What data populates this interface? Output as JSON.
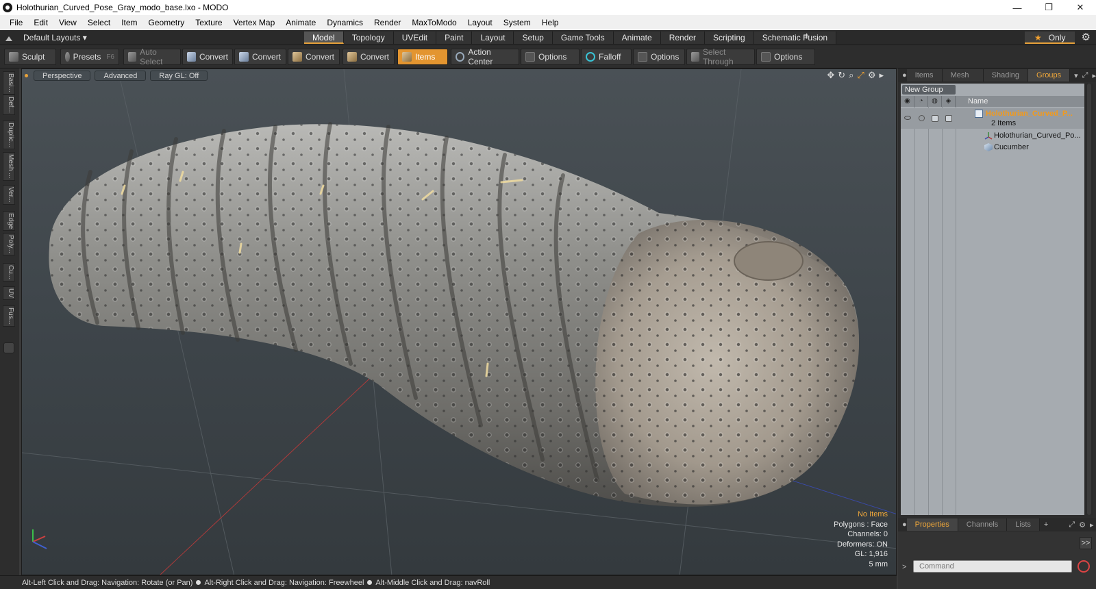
{
  "window": {
    "title": "Holothurian_Curved_Pose_Gray_modo_base.lxo - MODO",
    "controls": [
      "—",
      "❐",
      "✕"
    ]
  },
  "menu": [
    "File",
    "Edit",
    "View",
    "Select",
    "Item",
    "Geometry",
    "Texture",
    "Vertex Map",
    "Animate",
    "Dynamics",
    "Render",
    "MaxToModo",
    "Layout",
    "System",
    "Help"
  ],
  "layout_bar": {
    "layouts_label": "Default Layouts ▾",
    "tabs": [
      "Model",
      "Topology",
      "UVEdit",
      "Paint",
      "Layout",
      "Setup",
      "Game Tools",
      "Animate",
      "Render",
      "Scripting",
      "Schematic Fusion"
    ],
    "active_tab": "Model",
    "only_label": "Only"
  },
  "toolbar": {
    "sculpt": "Sculpt",
    "presets": "Presets",
    "presets_hotkey": "F6",
    "auto_select": "Auto Select",
    "convert1": "Convert",
    "convert2": "Convert",
    "convert3": "Convert",
    "convert4": "Convert",
    "items": "Items",
    "action_center": "Action Center",
    "options1": "Options",
    "falloff": "Falloff",
    "options2": "Options",
    "select_through": "Select Through",
    "options3": "Options"
  },
  "left_tabs": [
    "Basi...",
    "Def...",
    "Duplic...",
    "Mesh ...",
    "Ver...",
    "Edge",
    "Poly...",
    "Cu...",
    "UV",
    "Fus..."
  ],
  "viewport": {
    "view_mode": "Perspective",
    "shading": "Advanced",
    "raygl": "Ray GL: Off",
    "info": {
      "selection": "No Items",
      "polygons": "Polygons : Face",
      "channels": "Channels: 0",
      "deformers": "Deformers: ON",
      "gl": "GL: 1,916",
      "scale": "5 mm"
    }
  },
  "statusbar": {
    "hint1": "Alt-Left Click and Drag: Navigation: Rotate (or Pan)",
    "hint2": "Alt-Right Click and Drag: Navigation: Freewheel",
    "hint3": "Alt-Middle Click and Drag: navRoll"
  },
  "right_panel": {
    "top_tabs": [
      "Items",
      "Mesh ...",
      "Shading",
      "Groups"
    ],
    "active_top_tab": "Groups",
    "new_group": "New Group",
    "name_header": "Name",
    "rows": [
      {
        "name": "Holothurian_Curved_P...",
        "sub": "2 Items"
      },
      {
        "name": "Holothurian_Curved_Po..."
      },
      {
        "name": "Cucumber"
      }
    ],
    "bottom_tabs": [
      "Properties",
      "Channels",
      "Lists"
    ],
    "active_bottom_tab": "Properties",
    "expand_label": ">>",
    "command_placeholder": "Command"
  },
  "colors": {
    "accent": "#e8a23a",
    "group_name": "#f29a1c"
  }
}
